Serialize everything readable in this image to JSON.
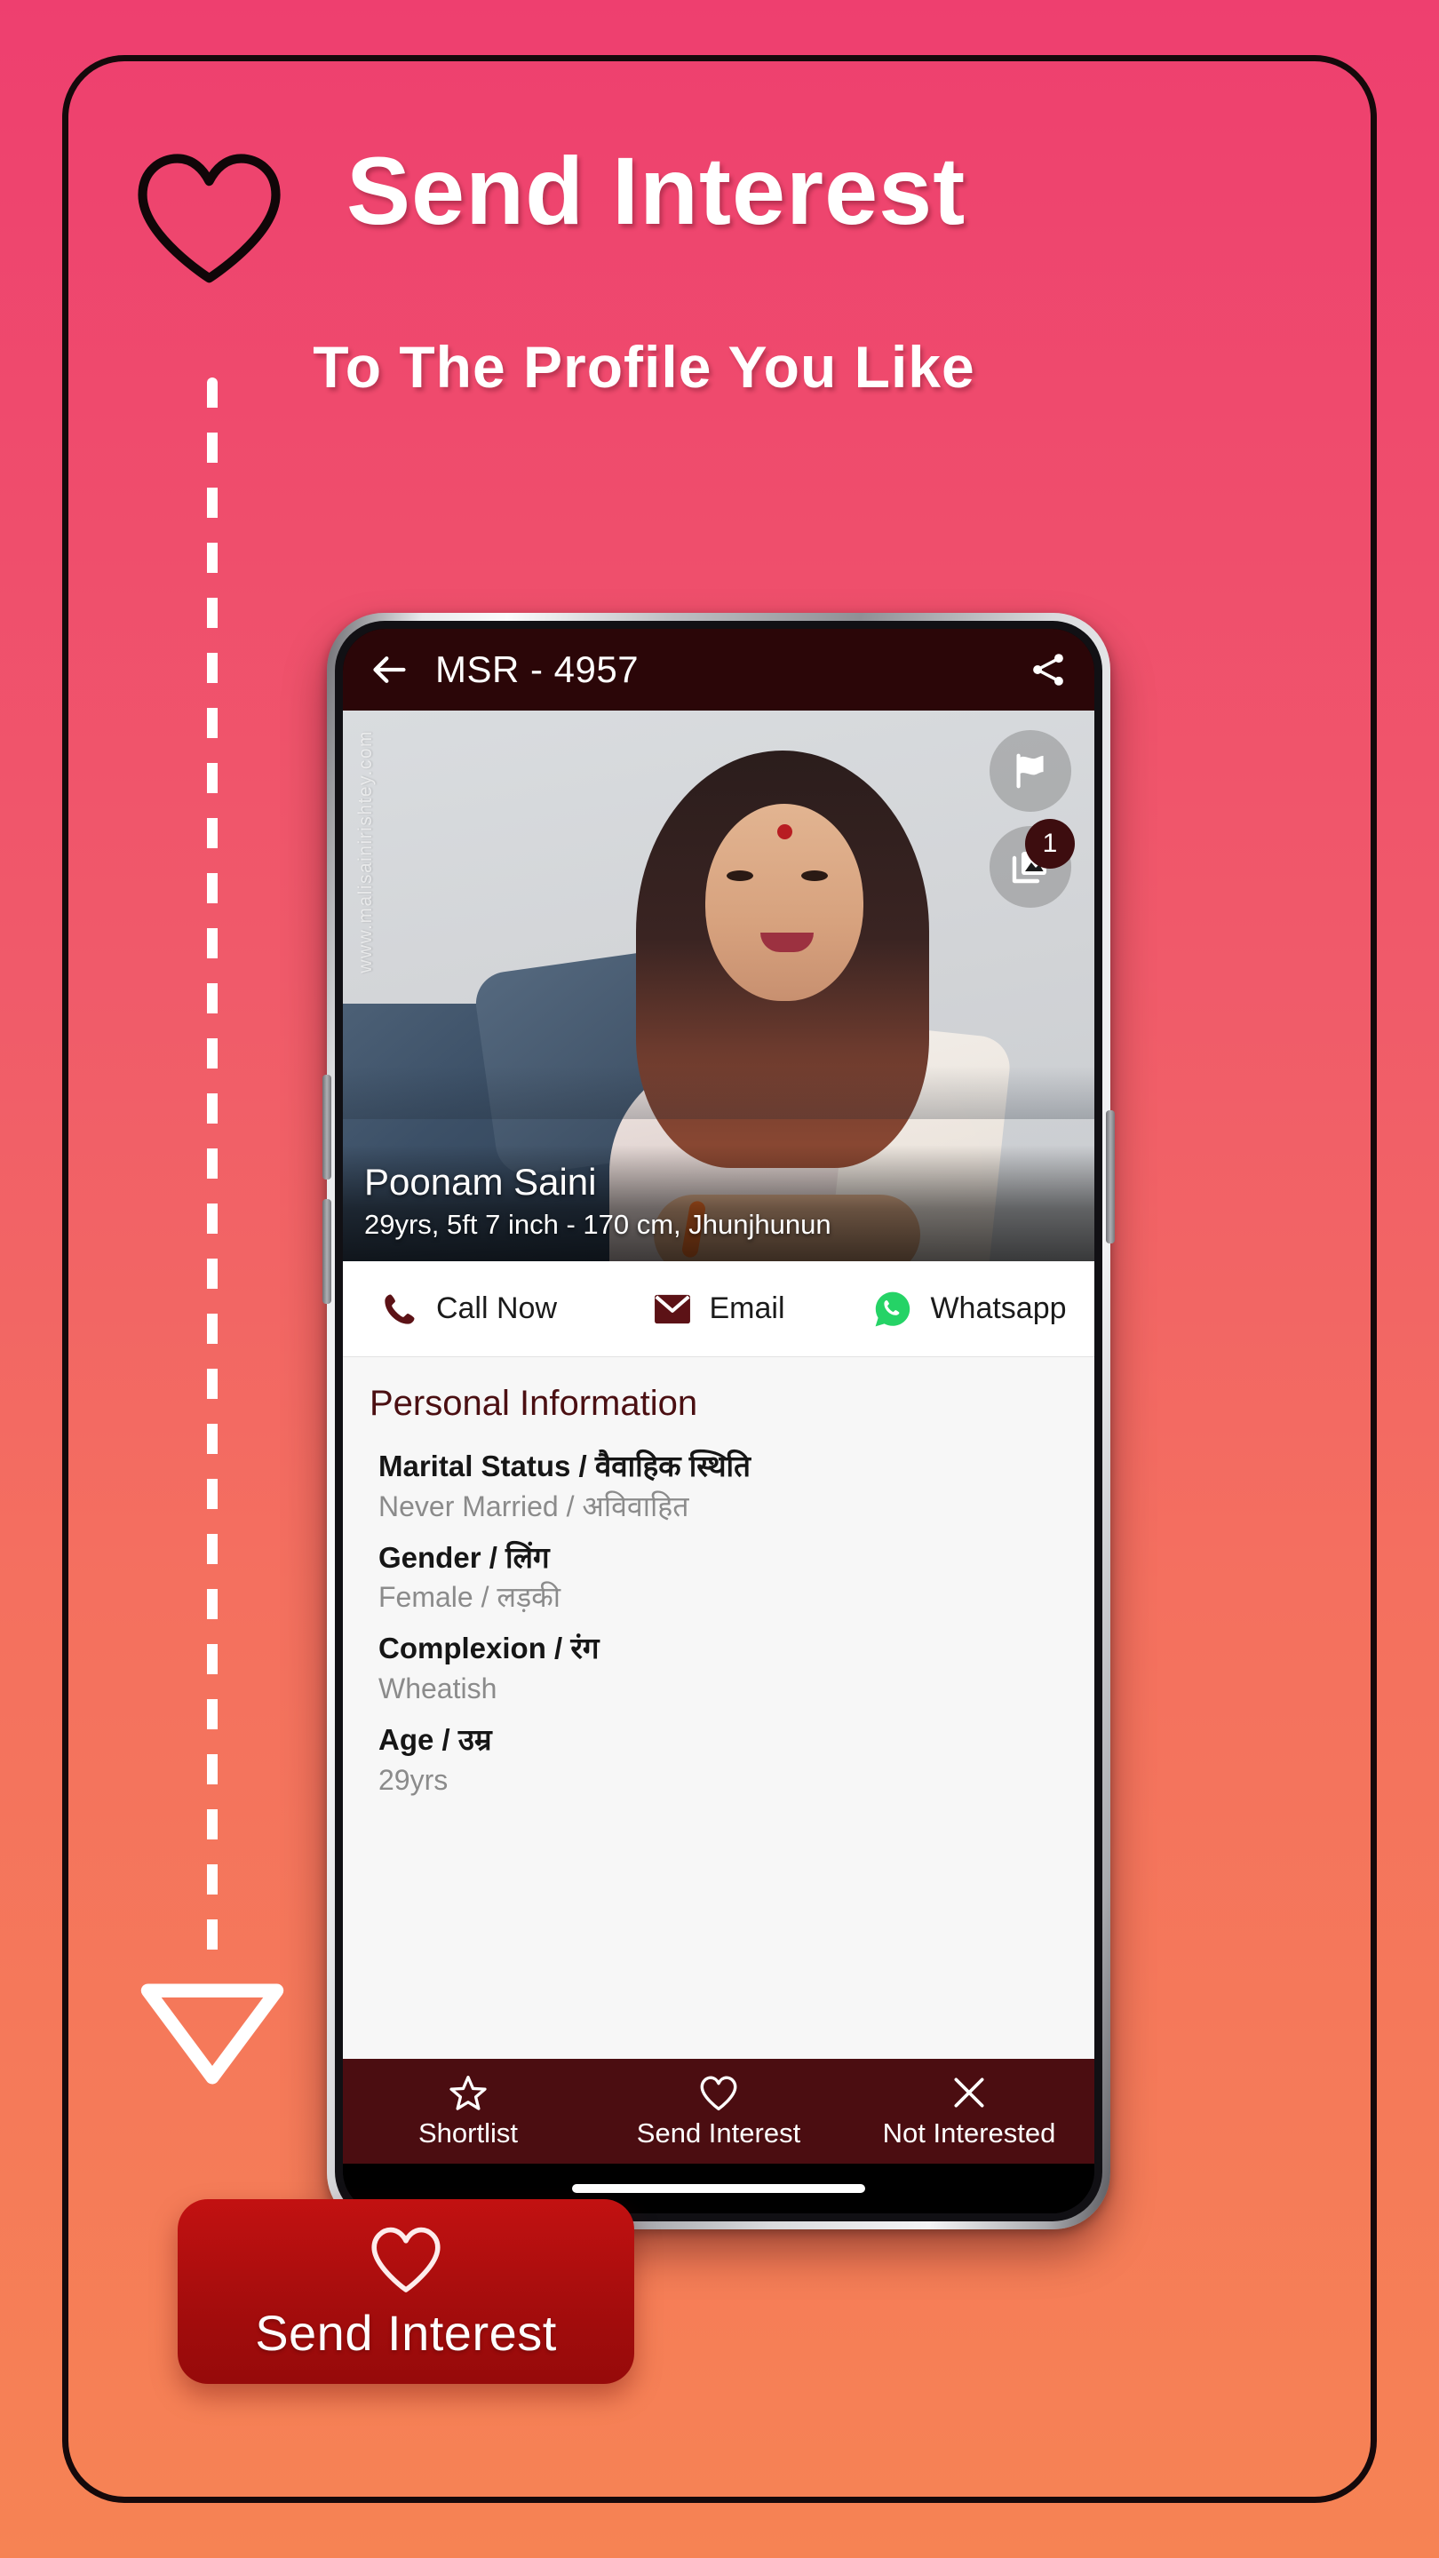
{
  "promo": {
    "heart_icon": "heart-outline-icon",
    "title": "Send Interest",
    "subtitle": "To The Profile You Like",
    "arrow_icon": "triangle-down-icon",
    "colors": {
      "gradient_top": "#ee3f6f",
      "gradient_bottom": "#f68354",
      "frame_border": "#15090b",
      "callout_red": "#b51010"
    }
  },
  "callout": {
    "heart_icon": "heart-outline-icon",
    "label": "Send Interest"
  },
  "app": {
    "app_bar": {
      "back_icon": "arrow-left-icon",
      "title": "MSR - 4957",
      "share_icon": "share-icon"
    },
    "photo": {
      "watermark": "www.malisainirishtey.com",
      "flag_icon": "flag-icon",
      "gallery_icon": "gallery-icon",
      "photo_count": "1",
      "name": "Poonam Saini",
      "meta": "29yrs, 5ft 7 inch - 170 cm, Jhunjhunun"
    },
    "contact_actions": [
      {
        "icon": "phone-icon",
        "label": "Call Now",
        "color": "#5c1216"
      },
      {
        "icon": "email-icon",
        "label": "Email",
        "color": "#5c1216"
      },
      {
        "icon": "whatsapp-icon",
        "label": "Whatsapp",
        "color": "#25d366"
      }
    ],
    "personal_information": {
      "heading": "Personal Information",
      "fields": [
        {
          "key": "Marital Status / वैवाहिक स्थिति",
          "value": "Never Married / अविवाहित"
        },
        {
          "key": "Gender / लिंग",
          "value": "Female / लड़की"
        },
        {
          "key": "Complexion / रंग",
          "value": "Wheatish"
        },
        {
          "key": "Age / उम्र",
          "value": "29yrs"
        }
      ]
    },
    "bottom_nav": [
      {
        "icon": "star-outline-icon",
        "label": "Shortlist"
      },
      {
        "icon": "heart-outline-icon",
        "label": "Send Interest"
      },
      {
        "icon": "close-x-icon",
        "label": "Not Interested"
      }
    ]
  }
}
